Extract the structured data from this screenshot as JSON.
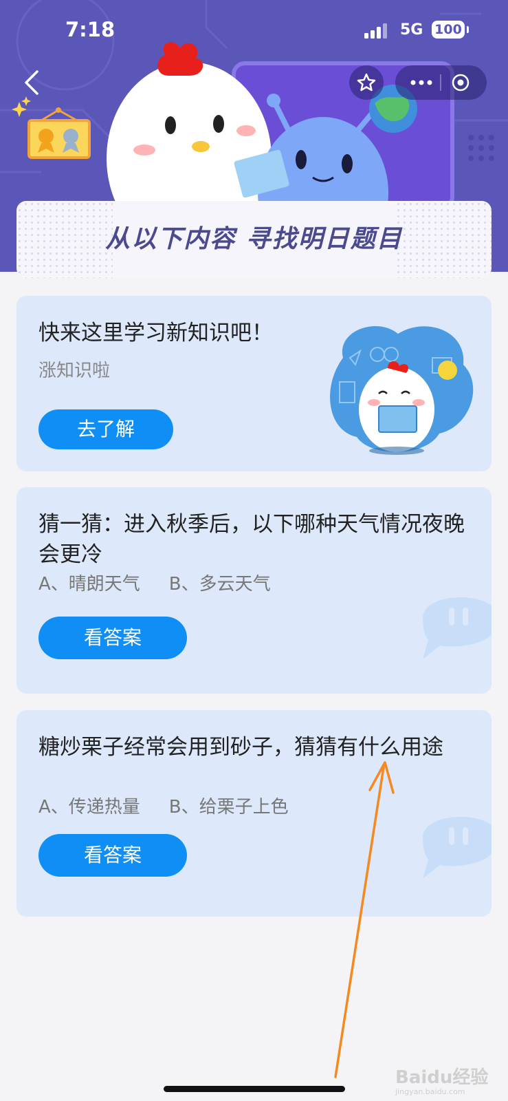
{
  "status": {
    "time": "7:18",
    "network": "5G",
    "battery": "100"
  },
  "banner": {
    "title": "从以下内容 寻找明日题目"
  },
  "promo": {
    "title": "快来这里学习新知识吧！",
    "subtitle": "涨知识啦",
    "button": "去了解"
  },
  "questions": [
    {
      "text": "猜一猜：进入秋季后，以下哪种天气情况夜晚会更冷",
      "option_a": "A、晴朗天气",
      "option_b": "B、多云天气",
      "button": "看答案"
    },
    {
      "text": "糖炒栗子经常会用到砂子，猜猜有什么用途",
      "option_a": "A、传递热量",
      "option_b": "B、给栗子上色",
      "button": "看答案"
    }
  ],
  "watermark": {
    "brand": "Baidu经验",
    "url": "jingyan.baidu.com"
  },
  "colors": {
    "header": "#5b57b8",
    "card": "#dde9fb",
    "button": "#0f8ef5",
    "arrow": "#f5891f"
  },
  "icons": [
    "back-icon",
    "star-icon",
    "more-icon",
    "close-target-icon",
    "medal-icon",
    "chick-mascot",
    "alien-mascot",
    "globe-icon",
    "chat-bubble-icon"
  ]
}
